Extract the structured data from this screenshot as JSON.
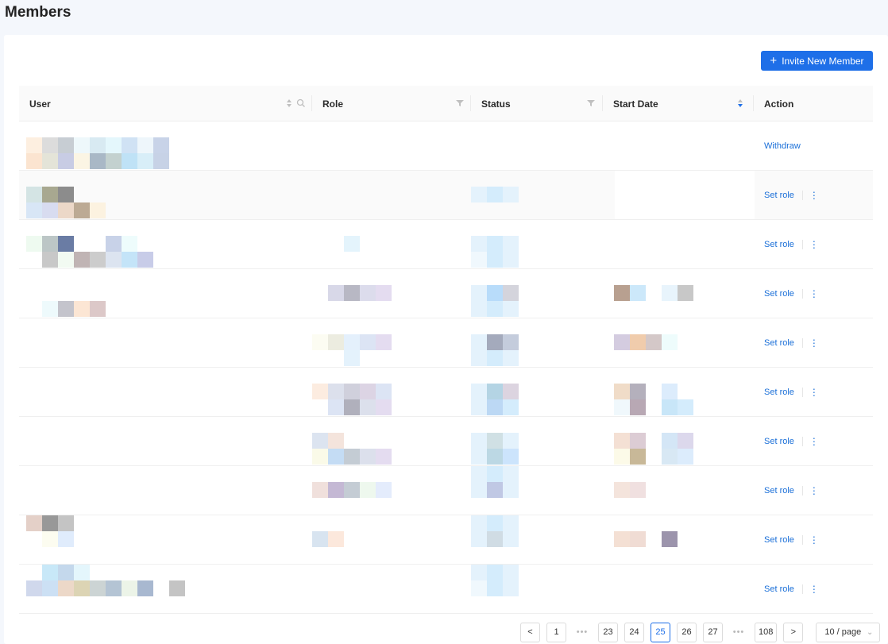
{
  "page": {
    "title": "Members"
  },
  "toolbar": {
    "invite_label": "Invite New Member",
    "invite_icon": "plus-icon"
  },
  "table": {
    "columns": [
      {
        "key": "user",
        "label": "User"
      },
      {
        "key": "role",
        "label": "Role"
      },
      {
        "key": "status",
        "label": "Status"
      },
      {
        "key": "start_date",
        "label": "Start Date"
      },
      {
        "key": "action",
        "label": "Action"
      }
    ],
    "rows": [
      {
        "action": "Withdraw",
        "has_more": false
      },
      {
        "action": "Set role",
        "has_more": true
      },
      {
        "action": "Set role",
        "has_more": true
      },
      {
        "action": "Set role",
        "has_more": true
      },
      {
        "action": "Set role",
        "has_more": true
      },
      {
        "action": "Set role",
        "has_more": true
      },
      {
        "action": "Set role",
        "has_more": true
      },
      {
        "action": "Set role",
        "has_more": true
      },
      {
        "action": "Set role",
        "has_more": true
      },
      {
        "action": "Set role",
        "has_more": true
      }
    ],
    "more_icon": "⋮"
  },
  "pagination": {
    "prev": "<",
    "next": ">",
    "pages": [
      "1",
      "•••",
      "23",
      "24",
      "25",
      "26",
      "27",
      "•••",
      "108"
    ],
    "current": "25",
    "page_size": "10 / page"
  },
  "colors": {
    "accent": "#1e6fe8",
    "link": "#1a6fd8",
    "header_bg": "#fafafa"
  }
}
